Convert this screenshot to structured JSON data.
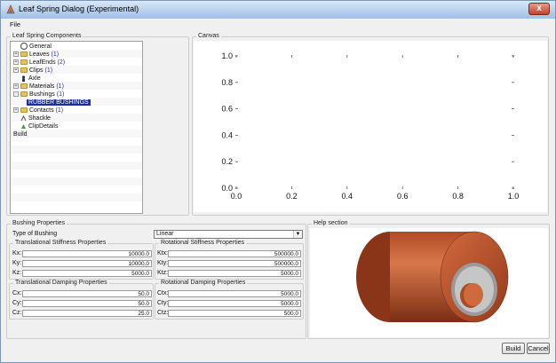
{
  "window": {
    "title": "Leaf Spring Dialog (Experimental)",
    "close_label": "x"
  },
  "menu": {
    "file": "File"
  },
  "components": {
    "group_label": "Leaf Spring Components",
    "tree": [
      {
        "label": "General",
        "count": "",
        "icon": "gear-icon"
      },
      {
        "label": "Leaves ",
        "count": "(1)",
        "icon": "folder-icon"
      },
      {
        "label": "LeafEnds ",
        "count": "(2)",
        "icon": "folder-icon"
      },
      {
        "label": "Clips ",
        "count": "(1)",
        "icon": "folder-icon"
      },
      {
        "label": "Axle",
        "count": "",
        "icon": "person-icon"
      },
      {
        "label": "Materials ",
        "count": "(1)",
        "icon": "folder-icon"
      },
      {
        "label": "Bushings ",
        "count": "(1)",
        "icon": "folder-open-icon"
      },
      {
        "label": "RUBBER BUSHINGS",
        "count": "",
        "icon": ""
      },
      {
        "label": "Contacts ",
        "count": "(1)",
        "icon": "folder-icon"
      },
      {
        "label": "Shackle",
        "count": "",
        "icon": "shackle-icon"
      },
      {
        "label": "ClipDetails",
        "count": "",
        "icon": "clip-icon"
      },
      {
        "label": "Build",
        "count": "",
        "icon": ""
      }
    ]
  },
  "canvas": {
    "group_label": "Canvas"
  },
  "chart_data": {
    "type": "scatter",
    "title": "",
    "xlabel": "",
    "ylabel": "",
    "xlim": [
      0.0,
      1.0
    ],
    "ylim": [
      0.0,
      1.0
    ],
    "x_ticks": [
      "0.0",
      "0.2",
      "0.4",
      "0.6",
      "0.8",
      "1.0"
    ],
    "y_ticks": [
      "0.0",
      "0.2",
      "0.4",
      "0.6",
      "0.8",
      "1.0"
    ],
    "series": [],
    "grid": false
  },
  "bushing": {
    "group_label": "Bushing Properties",
    "type_label": "Type of Bushing",
    "type_value": "Linear",
    "trans_stiff": {
      "label": "Translational Stiffness Properties",
      "rows": [
        {
          "label": "Kx:",
          "value": "10000.0"
        },
        {
          "label": "Ky:",
          "value": "10000.0"
        },
        {
          "label": "Kz:",
          "value": "5000.0"
        }
      ]
    },
    "rot_stiff": {
      "label": "Rotational Stiffness Properties",
      "rows": [
        {
          "label": "Ktx:",
          "value": "500000.0"
        },
        {
          "label": "Kty:",
          "value": "500000.0"
        },
        {
          "label": "Ktz:",
          "value": "5000.0"
        }
      ]
    },
    "trans_damp": {
      "label": "Translational Damping Properties",
      "rows": [
        {
          "label": "Cx:",
          "value": "50.0"
        },
        {
          "label": "Cy:",
          "value": "50.0"
        },
        {
          "label": "Cz:",
          "value": "25.0"
        }
      ]
    },
    "rot_damp": {
      "label": "Rotational Damping Properties",
      "rows": [
        {
          "label": "Ctx:",
          "value": "5000.0"
        },
        {
          "label": "Cty:",
          "value": "5000.0"
        },
        {
          "label": "Ctz:",
          "value": "500.0"
        }
      ]
    }
  },
  "help": {
    "group_label": "Help section"
  },
  "buttons": {
    "build": "Build",
    "cancel": "Cancel"
  },
  "colors": {
    "selection": "#1c2f9e",
    "bushing_rubber": "#c05a33",
    "bushing_steel": "#b0b0b0"
  }
}
